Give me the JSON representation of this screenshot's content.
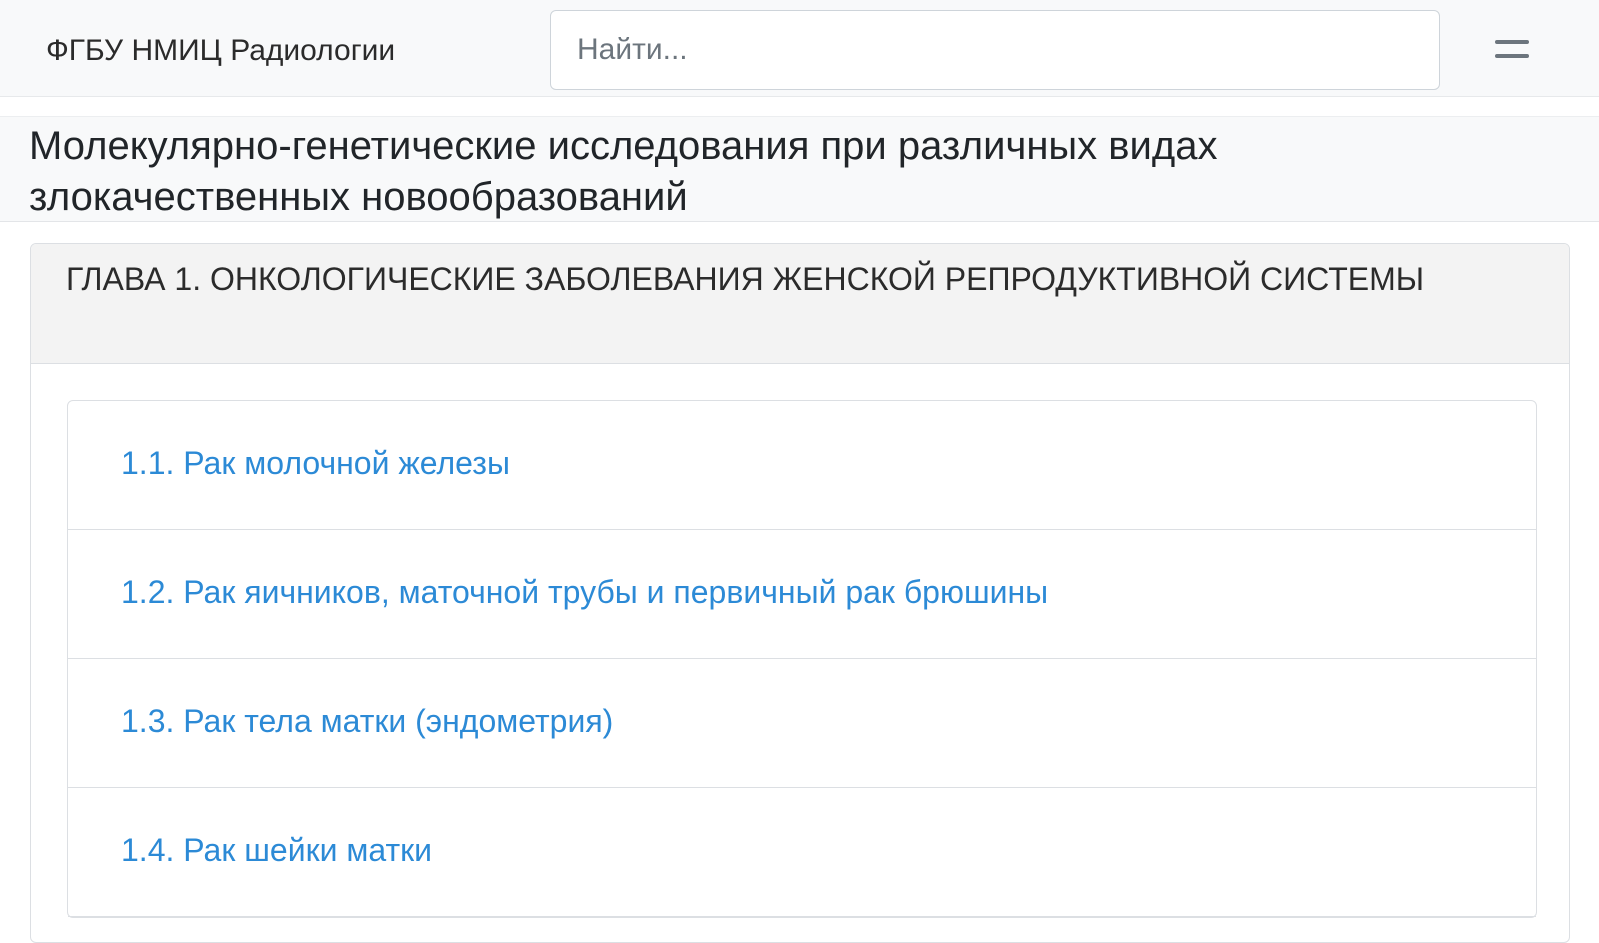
{
  "navbar": {
    "brand": "ФГБУ НМИЦ Радиологии",
    "search_placeholder": "Найти..."
  },
  "page": {
    "title": "Молекулярно-генетические исследования при различных видах злокачественных новообразований"
  },
  "chapter": {
    "title": "Глава 1. Онкологические заболевания женской репродуктивной системы",
    "items": [
      "1.1. Рак молочной железы",
      "1.2. Рак яичников, маточной трубы и первичный рак брюшины",
      "1.3. Рак тела матки (эндометрия)",
      "1.4. Рак шейки матки"
    ]
  },
  "colors": {
    "navbar_bg": "#f8f9fa",
    "link": "#2c8ad6",
    "card_header_bg": "#f3f3f3",
    "border": "#dcdfe3"
  },
  "icons": {
    "menu": "hamburger-menu-icon"
  }
}
